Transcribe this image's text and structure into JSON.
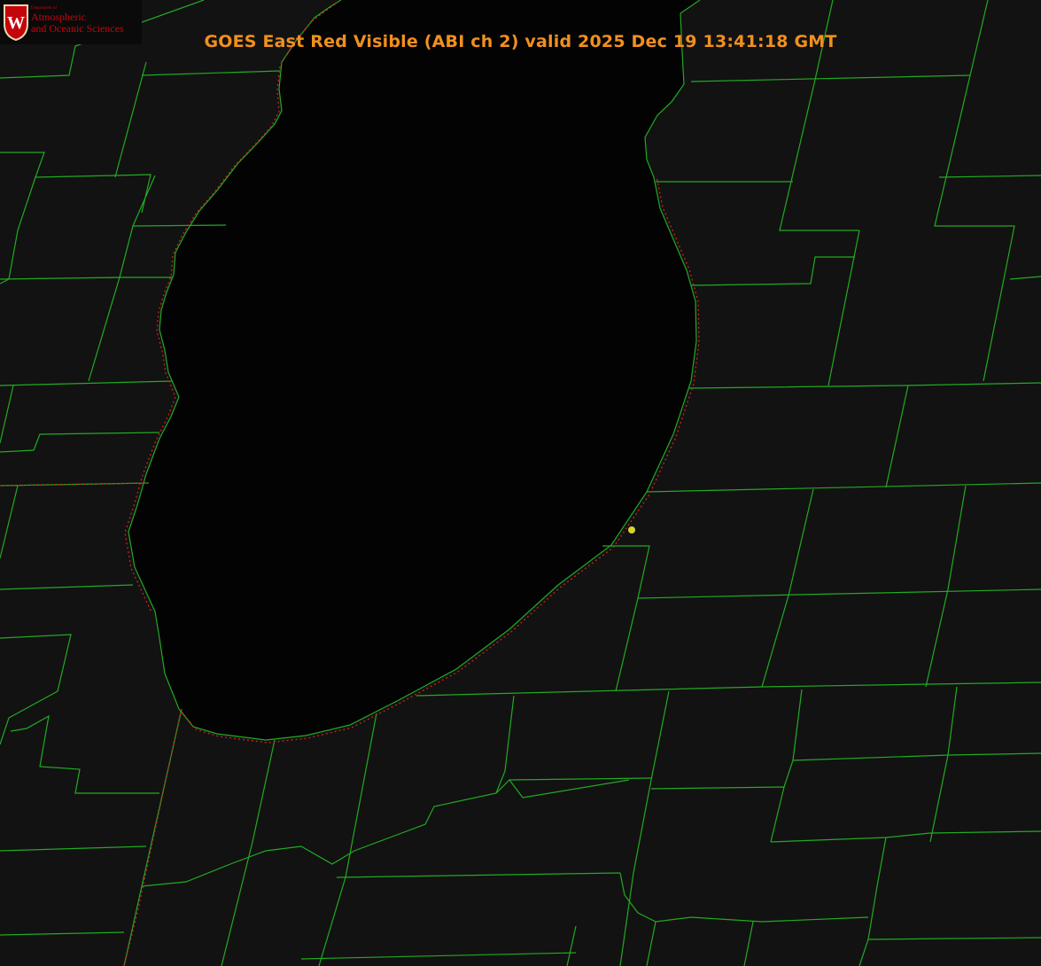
{
  "title": "GOES East Red Visible (ABI ch 2) valid 2025 Dec 19 13:41:18 GMT",
  "logo": {
    "department": "Department of",
    "line1": "Atmospheric",
    "line2": "and Oceanic Sciences",
    "crest_letter": "W"
  },
  "colors": {
    "title": "#f0901e",
    "county_lines": "#22aa22",
    "state_line": "#cc2222",
    "marker": "#d6d62a",
    "lake": "#030303",
    "land": "#121212"
  }
}
